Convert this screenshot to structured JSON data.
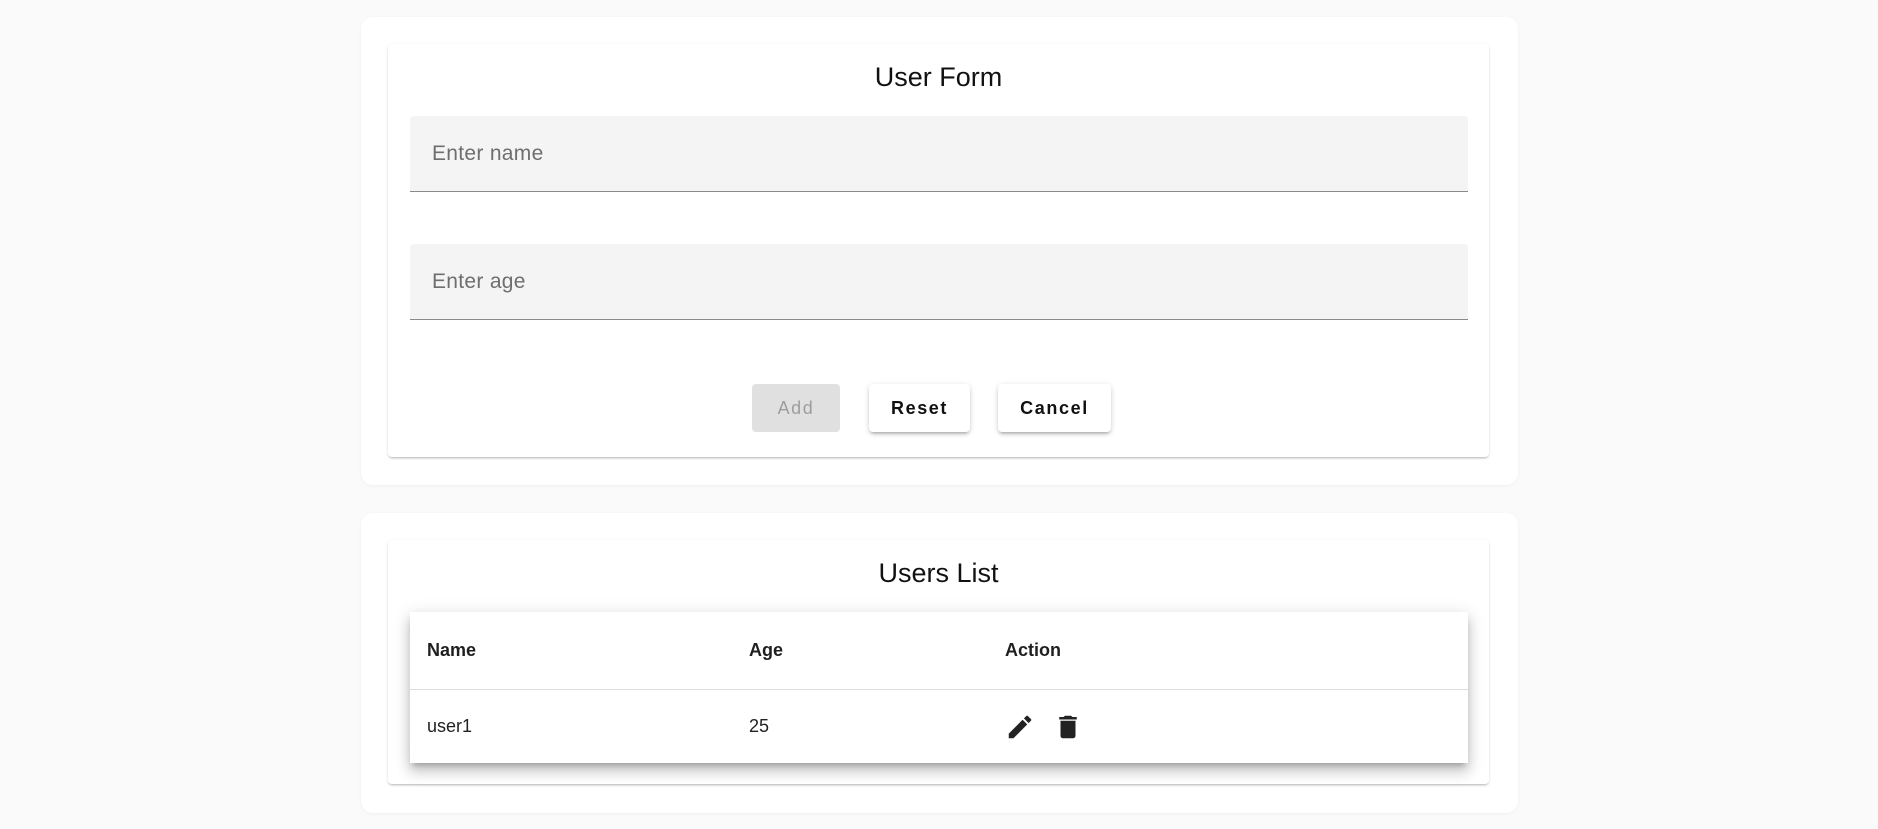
{
  "user_form": {
    "title": "User Form",
    "name_placeholder": "Enter name",
    "age_placeholder": "Enter age",
    "buttons": {
      "add": "Add",
      "reset": "Reset",
      "cancel": "Cancel"
    }
  },
  "users_list": {
    "title": "Users List",
    "columns": [
      "Name",
      "Age",
      "Action"
    ],
    "rows": [
      {
        "name": "user1",
        "age": "25",
        "actions": [
          "edit-icon",
          "delete-icon"
        ]
      }
    ]
  },
  "colors": {
    "page_bg": "#fafafa",
    "card_bg": "#ffffff",
    "field_bg": "#f4f4f4",
    "disabled_button_bg": "#e0e0e0",
    "disabled_button_text": "#9e9e9e",
    "icon": "#222222"
  }
}
